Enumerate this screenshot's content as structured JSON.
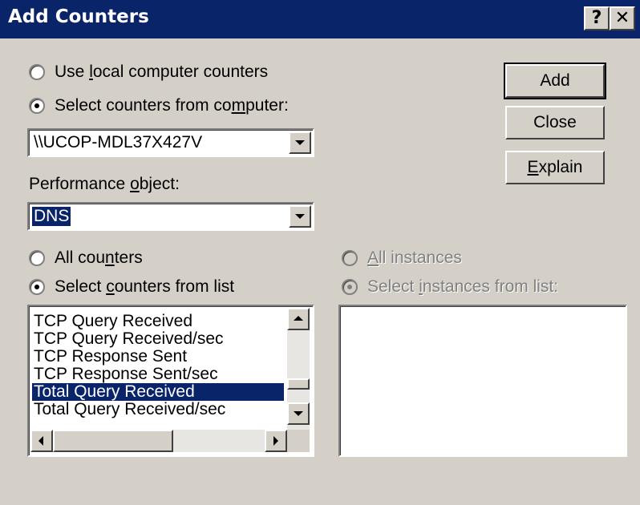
{
  "window": {
    "title": "Add Counters",
    "help_glyph": "?",
    "close_glyph": "✕"
  },
  "source": {
    "local_label_pre": "Use ",
    "local_label_acc": "l",
    "local_label_post": "ocal computer counters",
    "remote_label_pre": "Select counters from co",
    "remote_label_acc": "m",
    "remote_label_post": "puter:",
    "computer_value": "\\\\UCOP-MDL37X427V"
  },
  "perf_object": {
    "label_pre": "Performance ",
    "label_acc": "o",
    "label_post": "bject:",
    "value": "DNS"
  },
  "counters": {
    "all_pre": "All cou",
    "all_acc": "n",
    "all_post": "ters",
    "select_pre": "Select ",
    "select_acc": "c",
    "select_post": "ounters from list",
    "items": [
      "TCP Query Received",
      "TCP Query Received/sec",
      "TCP Response Sent",
      "TCP Response Sent/sec",
      "Total Query Received",
      "Total Query Received/sec"
    ],
    "selected_index": 4
  },
  "instances": {
    "all_acc": "A",
    "all_post": "ll instances",
    "select_pre": "Select ",
    "select_acc": "i",
    "select_post": "nstances from list:"
  },
  "buttons": {
    "add": "Add",
    "close": "Close",
    "explain_acc": "E",
    "explain_post": "xplain"
  }
}
